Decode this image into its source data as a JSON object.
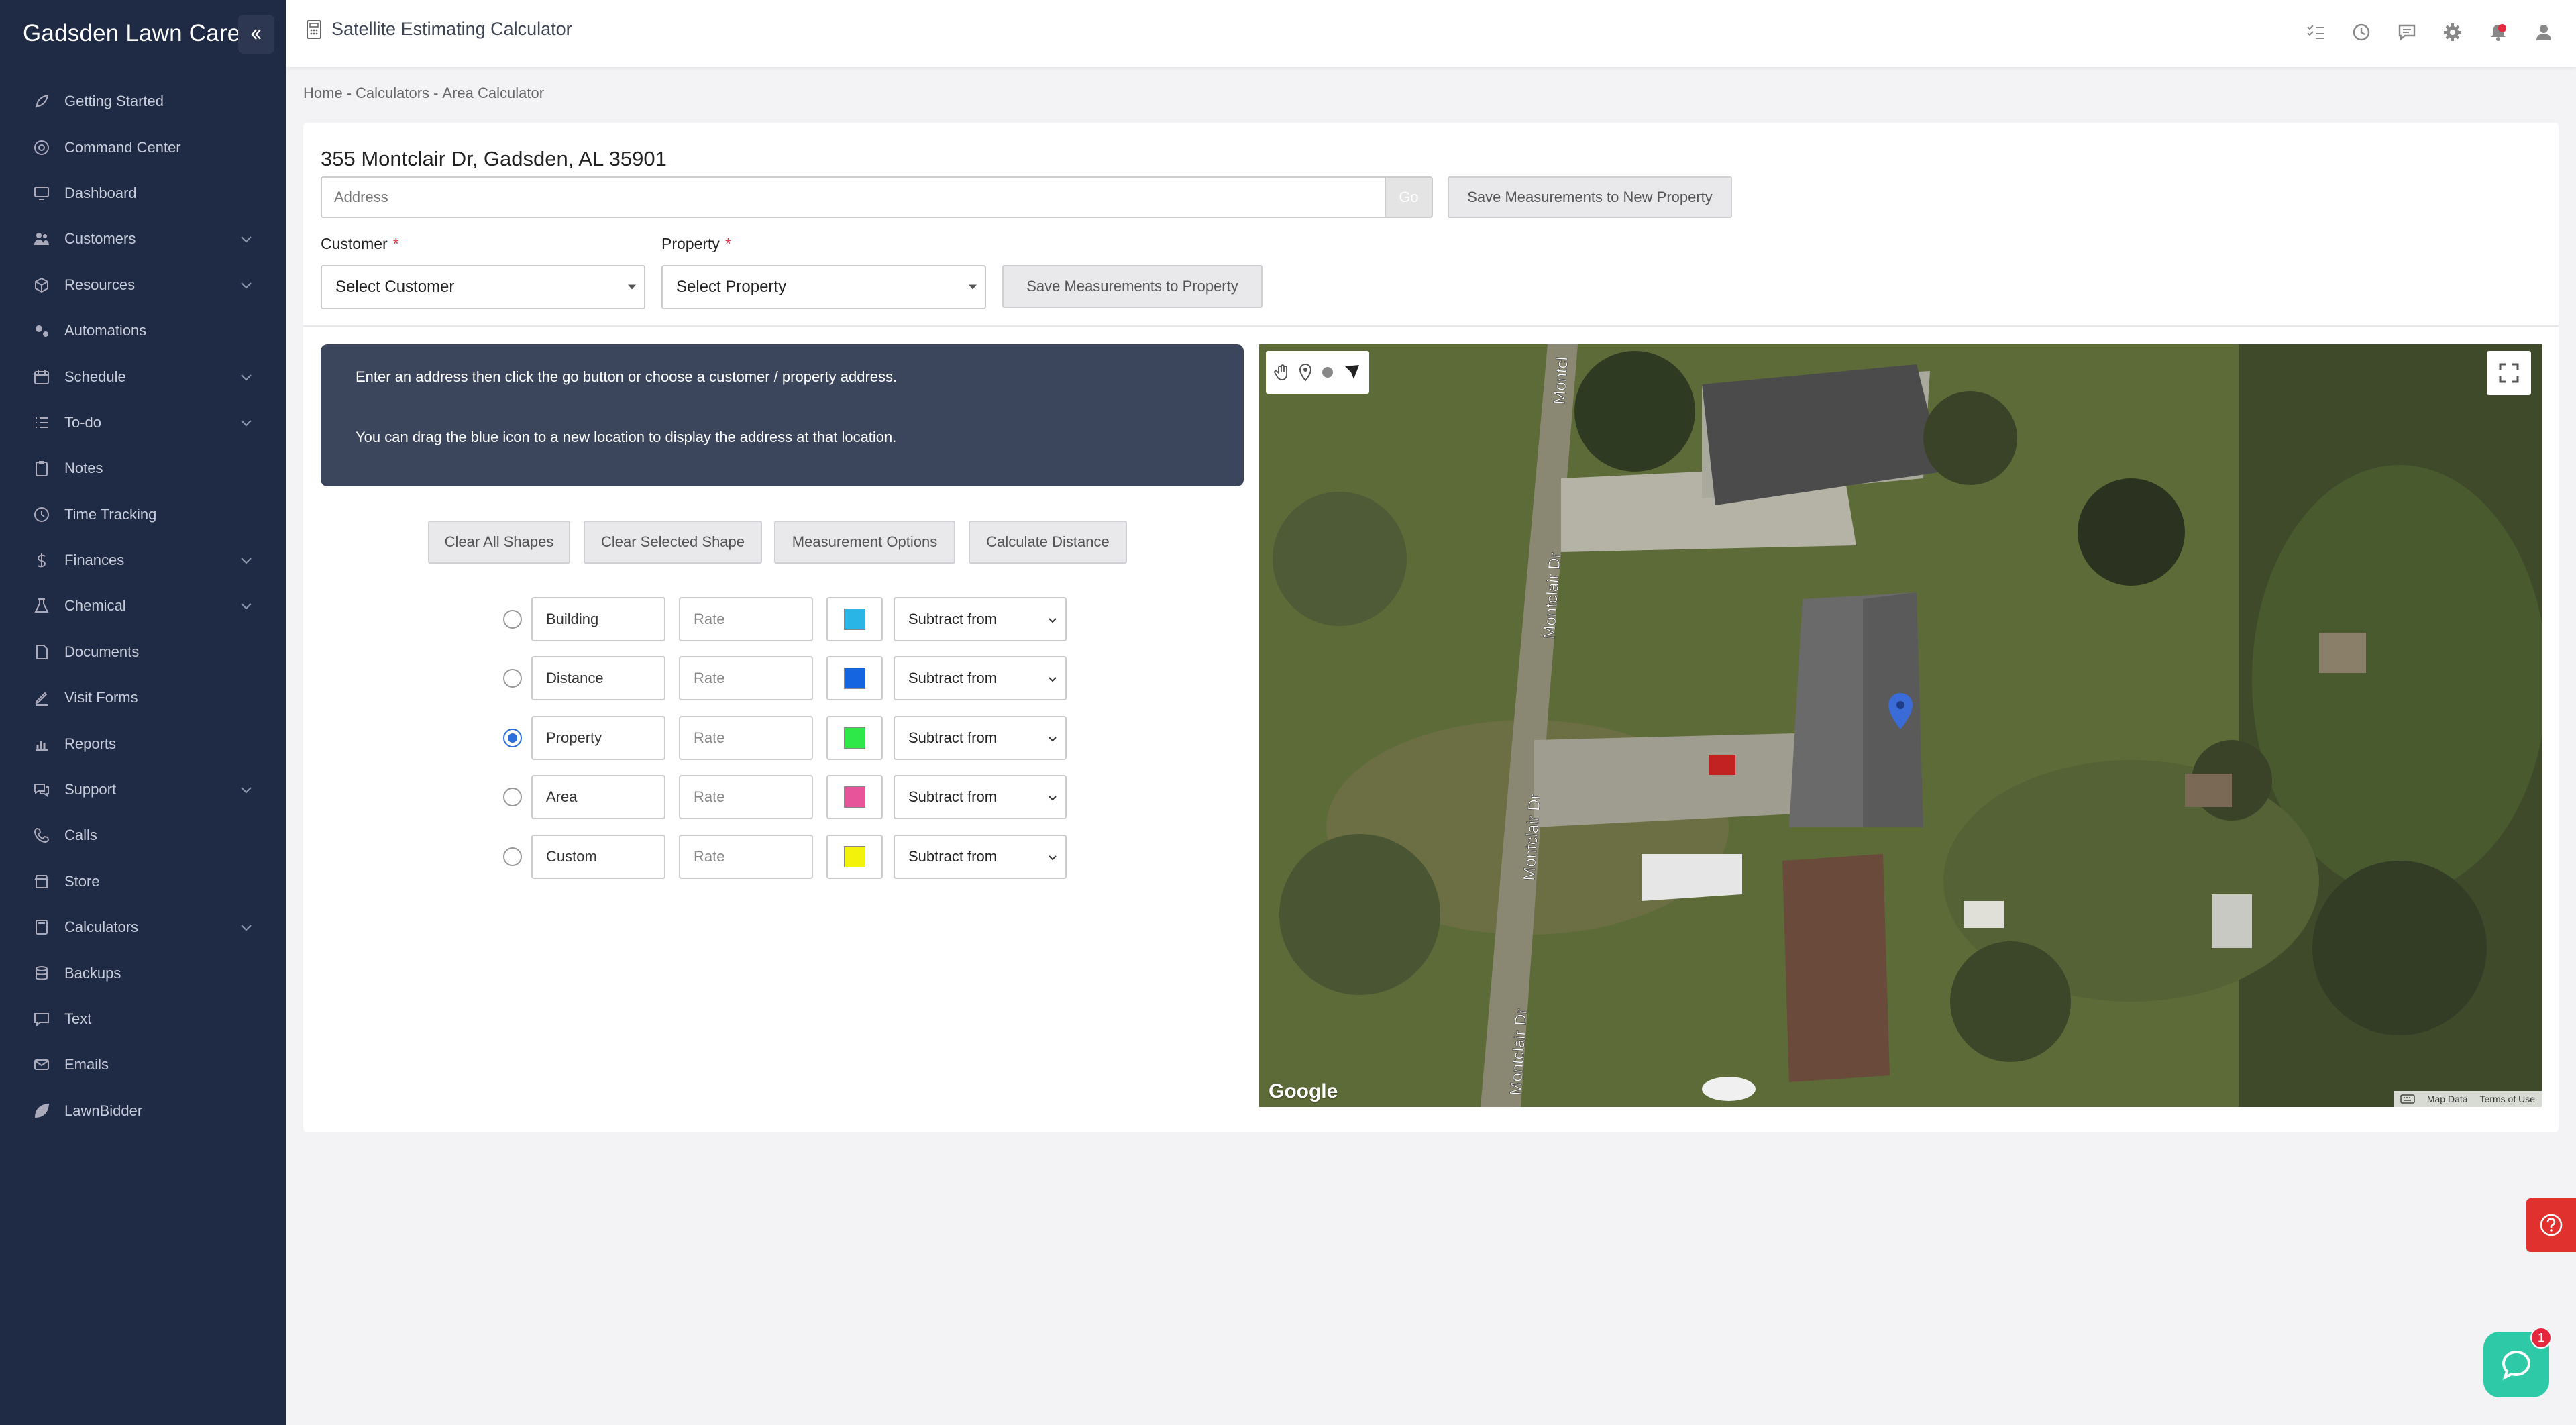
{
  "sidebar": {
    "brand": "Gadsden Lawn Care",
    "items": [
      {
        "label": "Getting Started",
        "icon": "rocket-icon",
        "expandable": false
      },
      {
        "label": "Command Center",
        "icon": "target-icon",
        "expandable": false
      },
      {
        "label": "Dashboard",
        "icon": "monitor-icon",
        "expandable": false
      },
      {
        "label": "Customers",
        "icon": "users-icon",
        "expandable": true
      },
      {
        "label": "Resources",
        "icon": "box-icon",
        "expandable": true
      },
      {
        "label": "Automations",
        "icon": "cogs-icon",
        "expandable": false
      },
      {
        "label": "Schedule",
        "icon": "calendar-icon",
        "expandable": true
      },
      {
        "label": "To-do",
        "icon": "list-icon",
        "expandable": true
      },
      {
        "label": "Notes",
        "icon": "clipboard-icon",
        "expandable": false
      },
      {
        "label": "Time Tracking",
        "icon": "clock-icon",
        "expandable": false
      },
      {
        "label": "Finances",
        "icon": "dollar-icon",
        "expandable": true
      },
      {
        "label": "Chemical",
        "icon": "flask-icon",
        "expandable": true
      },
      {
        "label": "Documents",
        "icon": "document-icon",
        "expandable": false
      },
      {
        "label": "Visit Forms",
        "icon": "edit-form-icon",
        "expandable": false
      },
      {
        "label": "Reports",
        "icon": "bar-chart-icon",
        "expandable": false
      },
      {
        "label": "Support",
        "icon": "chat-bubbles-icon",
        "expandable": true
      },
      {
        "label": "Calls",
        "icon": "phone-icon",
        "expandable": false
      },
      {
        "label": "Store",
        "icon": "store-icon",
        "expandable": false
      },
      {
        "label": "Calculators",
        "icon": "calculator-icon",
        "expandable": true
      },
      {
        "label": "Backups",
        "icon": "database-icon",
        "expandable": false
      },
      {
        "label": "Text",
        "icon": "message-icon",
        "expandable": false
      },
      {
        "label": "Emails",
        "icon": "envelope-icon",
        "expandable": false
      },
      {
        "label": "LawnBidder",
        "icon": "leaf-icon",
        "expandable": false
      }
    ]
  },
  "header": {
    "title": "Satellite Estimating Calculator",
    "icons": [
      "checklist-icon",
      "history-icon",
      "comment-icon",
      "settings-icon",
      "notification-bell-icon",
      "user-icon"
    ]
  },
  "breadcrumb": {
    "items": [
      "Home",
      "Calculators",
      "Area Calculator"
    ],
    "separator": "-"
  },
  "form": {
    "address_title": "355 Montclair Dr, Gadsden, AL 35901",
    "address_placeholder": "Address",
    "go_label": "Go",
    "save_new_label": "Save Measurements to New Property",
    "customer_label": "Customer",
    "customer_select": "Select Customer",
    "property_label": "Property",
    "property_select": "Select Property",
    "required_mark": "*",
    "save_property_label": "Save Measurements to Property"
  },
  "info": {
    "line1": "Enter an address then click the go button or choose a customer / property address.",
    "line2": "You can drag the blue icon to a new location to display the address at that location."
  },
  "actions": {
    "clear_all": "Clear All Shapes",
    "clear_selected": "Clear Selected Shape",
    "measurement_options": "Measurement Options",
    "calculate_distance": "Calculate Distance"
  },
  "shapes": [
    {
      "name": "Building",
      "rate_placeholder": "Rate",
      "color": "#29b6e6",
      "operation": "Subtract from",
      "selected": false
    },
    {
      "name": "Distance",
      "rate_placeholder": "Rate",
      "color": "#1565e0",
      "operation": "Subtract from",
      "selected": false
    },
    {
      "name": "Property",
      "rate_placeholder": "Rate",
      "color": "#2ee84a",
      "operation": "Subtract from",
      "selected": true
    },
    {
      "name": "Area",
      "rate_placeholder": "Rate",
      "color": "#e8549a",
      "operation": "Subtract from",
      "selected": false
    },
    {
      "name": "Custom",
      "rate_placeholder": "Rate",
      "color": "#f2f20a",
      "operation": "Subtract from",
      "selected": false
    }
  ],
  "map": {
    "street_labels": [
      "Montclair Dr",
      "Montclair Dr",
      "Montclair Dr",
      "Montcl"
    ],
    "logo": "Google",
    "attribution": [
      "Map Data",
      "Terms of Use"
    ],
    "tools": [
      "hand-pan-icon",
      "marker-icon",
      "circle-icon",
      "polygon-icon"
    ]
  },
  "colors": {
    "sidebar_bg": "#1f2a44",
    "info_bg": "#3b465d",
    "radio_accent": "#2a6fdb",
    "help_red": "#e0312f",
    "chat_teal": "#2ec9a7"
  },
  "chat": {
    "badge": "1"
  }
}
